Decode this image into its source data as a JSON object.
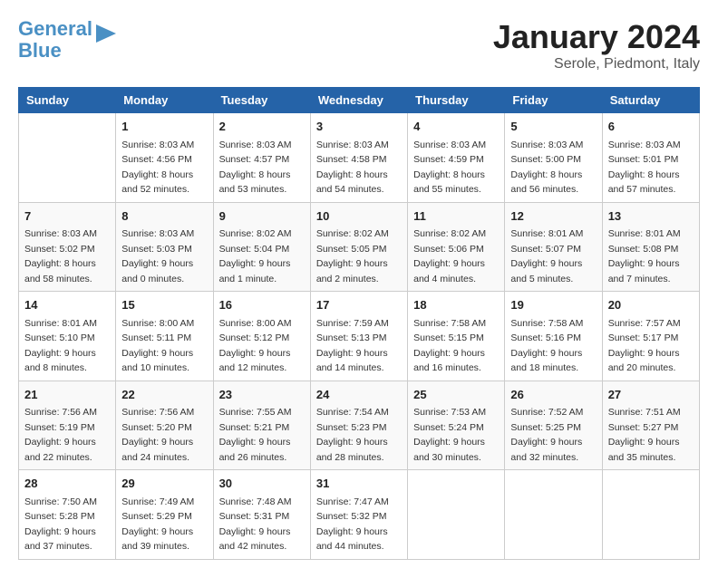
{
  "header": {
    "logo_line1": "General",
    "logo_line2": "Blue",
    "month_year": "January 2024",
    "location": "Serole, Piedmont, Italy"
  },
  "weekdays": [
    "Sunday",
    "Monday",
    "Tuesday",
    "Wednesday",
    "Thursday",
    "Friday",
    "Saturday"
  ],
  "weeks": [
    [
      {
        "day": "",
        "sunrise": "",
        "sunset": "",
        "daylight": ""
      },
      {
        "day": "1",
        "sunrise": "Sunrise: 8:03 AM",
        "sunset": "Sunset: 4:56 PM",
        "daylight": "Daylight: 8 hours and 52 minutes."
      },
      {
        "day": "2",
        "sunrise": "Sunrise: 8:03 AM",
        "sunset": "Sunset: 4:57 PM",
        "daylight": "Daylight: 8 hours and 53 minutes."
      },
      {
        "day": "3",
        "sunrise": "Sunrise: 8:03 AM",
        "sunset": "Sunset: 4:58 PM",
        "daylight": "Daylight: 8 hours and 54 minutes."
      },
      {
        "day": "4",
        "sunrise": "Sunrise: 8:03 AM",
        "sunset": "Sunset: 4:59 PM",
        "daylight": "Daylight: 8 hours and 55 minutes."
      },
      {
        "day": "5",
        "sunrise": "Sunrise: 8:03 AM",
        "sunset": "Sunset: 5:00 PM",
        "daylight": "Daylight: 8 hours and 56 minutes."
      },
      {
        "day": "6",
        "sunrise": "Sunrise: 8:03 AM",
        "sunset": "Sunset: 5:01 PM",
        "daylight": "Daylight: 8 hours and 57 minutes."
      }
    ],
    [
      {
        "day": "7",
        "sunrise": "Sunrise: 8:03 AM",
        "sunset": "Sunset: 5:02 PM",
        "daylight": "Daylight: 8 hours and 58 minutes."
      },
      {
        "day": "8",
        "sunrise": "Sunrise: 8:03 AM",
        "sunset": "Sunset: 5:03 PM",
        "daylight": "Daylight: 9 hours and 0 minutes."
      },
      {
        "day": "9",
        "sunrise": "Sunrise: 8:02 AM",
        "sunset": "Sunset: 5:04 PM",
        "daylight": "Daylight: 9 hours and 1 minute."
      },
      {
        "day": "10",
        "sunrise": "Sunrise: 8:02 AM",
        "sunset": "Sunset: 5:05 PM",
        "daylight": "Daylight: 9 hours and 2 minutes."
      },
      {
        "day": "11",
        "sunrise": "Sunrise: 8:02 AM",
        "sunset": "Sunset: 5:06 PM",
        "daylight": "Daylight: 9 hours and 4 minutes."
      },
      {
        "day": "12",
        "sunrise": "Sunrise: 8:01 AM",
        "sunset": "Sunset: 5:07 PM",
        "daylight": "Daylight: 9 hours and 5 minutes."
      },
      {
        "day": "13",
        "sunrise": "Sunrise: 8:01 AM",
        "sunset": "Sunset: 5:08 PM",
        "daylight": "Daylight: 9 hours and 7 minutes."
      }
    ],
    [
      {
        "day": "14",
        "sunrise": "Sunrise: 8:01 AM",
        "sunset": "Sunset: 5:10 PM",
        "daylight": "Daylight: 9 hours and 8 minutes."
      },
      {
        "day": "15",
        "sunrise": "Sunrise: 8:00 AM",
        "sunset": "Sunset: 5:11 PM",
        "daylight": "Daylight: 9 hours and 10 minutes."
      },
      {
        "day": "16",
        "sunrise": "Sunrise: 8:00 AM",
        "sunset": "Sunset: 5:12 PM",
        "daylight": "Daylight: 9 hours and 12 minutes."
      },
      {
        "day": "17",
        "sunrise": "Sunrise: 7:59 AM",
        "sunset": "Sunset: 5:13 PM",
        "daylight": "Daylight: 9 hours and 14 minutes."
      },
      {
        "day": "18",
        "sunrise": "Sunrise: 7:58 AM",
        "sunset": "Sunset: 5:15 PM",
        "daylight": "Daylight: 9 hours and 16 minutes."
      },
      {
        "day": "19",
        "sunrise": "Sunrise: 7:58 AM",
        "sunset": "Sunset: 5:16 PM",
        "daylight": "Daylight: 9 hours and 18 minutes."
      },
      {
        "day": "20",
        "sunrise": "Sunrise: 7:57 AM",
        "sunset": "Sunset: 5:17 PM",
        "daylight": "Daylight: 9 hours and 20 minutes."
      }
    ],
    [
      {
        "day": "21",
        "sunrise": "Sunrise: 7:56 AM",
        "sunset": "Sunset: 5:19 PM",
        "daylight": "Daylight: 9 hours and 22 minutes."
      },
      {
        "day": "22",
        "sunrise": "Sunrise: 7:56 AM",
        "sunset": "Sunset: 5:20 PM",
        "daylight": "Daylight: 9 hours and 24 minutes."
      },
      {
        "day": "23",
        "sunrise": "Sunrise: 7:55 AM",
        "sunset": "Sunset: 5:21 PM",
        "daylight": "Daylight: 9 hours and 26 minutes."
      },
      {
        "day": "24",
        "sunrise": "Sunrise: 7:54 AM",
        "sunset": "Sunset: 5:23 PM",
        "daylight": "Daylight: 9 hours and 28 minutes."
      },
      {
        "day": "25",
        "sunrise": "Sunrise: 7:53 AM",
        "sunset": "Sunset: 5:24 PM",
        "daylight": "Daylight: 9 hours and 30 minutes."
      },
      {
        "day": "26",
        "sunrise": "Sunrise: 7:52 AM",
        "sunset": "Sunset: 5:25 PM",
        "daylight": "Daylight: 9 hours and 32 minutes."
      },
      {
        "day": "27",
        "sunrise": "Sunrise: 7:51 AM",
        "sunset": "Sunset: 5:27 PM",
        "daylight": "Daylight: 9 hours and 35 minutes."
      }
    ],
    [
      {
        "day": "28",
        "sunrise": "Sunrise: 7:50 AM",
        "sunset": "Sunset: 5:28 PM",
        "daylight": "Daylight: 9 hours and 37 minutes."
      },
      {
        "day": "29",
        "sunrise": "Sunrise: 7:49 AM",
        "sunset": "Sunset: 5:29 PM",
        "daylight": "Daylight: 9 hours and 39 minutes."
      },
      {
        "day": "30",
        "sunrise": "Sunrise: 7:48 AM",
        "sunset": "Sunset: 5:31 PM",
        "daylight": "Daylight: 9 hours and 42 minutes."
      },
      {
        "day": "31",
        "sunrise": "Sunrise: 7:47 AM",
        "sunset": "Sunset: 5:32 PM",
        "daylight": "Daylight: 9 hours and 44 minutes."
      },
      {
        "day": "",
        "sunrise": "",
        "sunset": "",
        "daylight": ""
      },
      {
        "day": "",
        "sunrise": "",
        "sunset": "",
        "daylight": ""
      },
      {
        "day": "",
        "sunrise": "",
        "sunset": "",
        "daylight": ""
      }
    ]
  ]
}
